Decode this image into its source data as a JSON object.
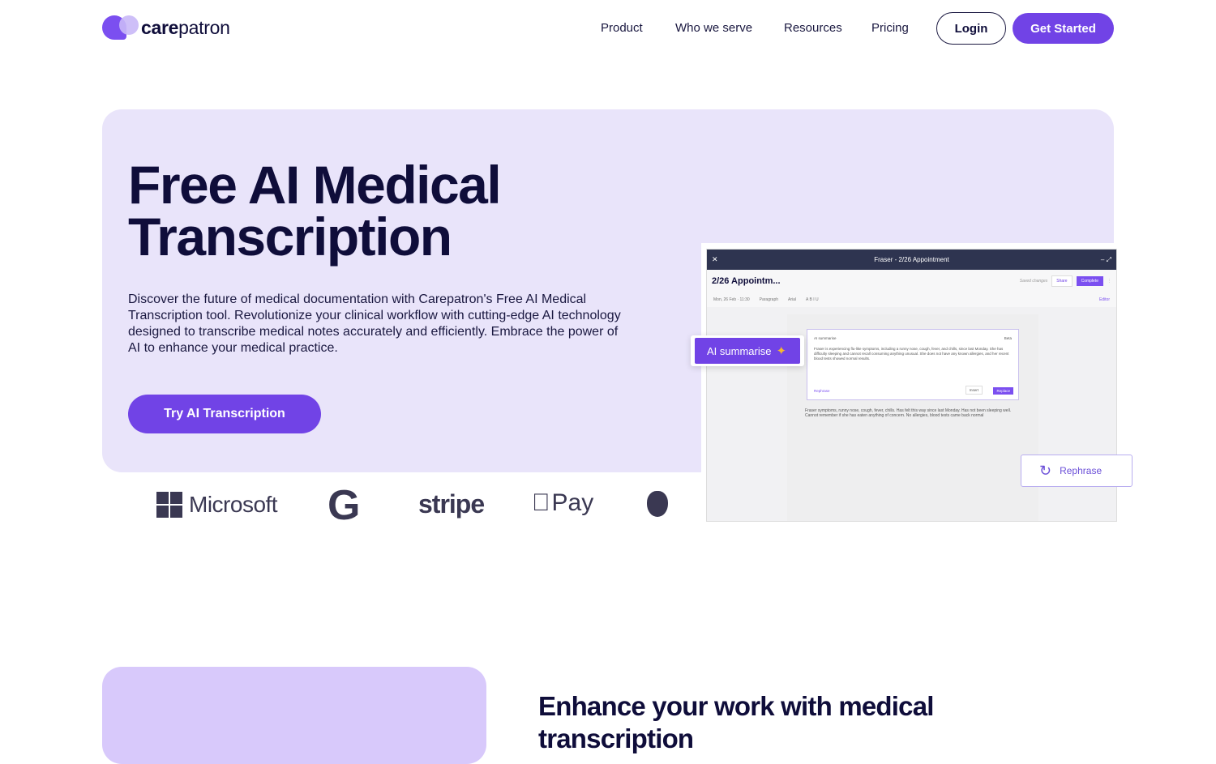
{
  "nav": {
    "brand_bold": "care",
    "brand_light": "patron",
    "items": [
      {
        "label": "Product"
      },
      {
        "label": "Who we serve"
      },
      {
        "label": "Resources"
      },
      {
        "label": "Pricing"
      }
    ],
    "login_label": "Login",
    "get_started_label": "Get Started"
  },
  "hero": {
    "title": "Free AI Medical Transcription",
    "description": "Discover the future of medical documentation with Carepatron's Free AI Medical Transcription tool. Revolutionize your clinical workflow with cutting-edge AI technology designed to transcribe medical notes accurately and efficiently. Embrace the power of AI to enhance your medical practice.",
    "cta_label": "Try AI Transcription"
  },
  "logos": [
    "Microsoft",
    "G",
    "stripe",
    "Pay"
  ],
  "mockup": {
    "window_title": "Fraser - 2/26 Appointment",
    "doc_title": "2/26 Appointm...",
    "saved": "Saved changes",
    "share": "Share",
    "complete": "Complete",
    "date": "Mon, 26 Feb · 11:30",
    "paragraph": "Paragraph",
    "font": "Arial",
    "editor": "Editor",
    "summary_label": "AI summarise",
    "beta": "Beta",
    "summary_text": "Fraser is experiencing flu-like symptoms, including a runny nose, cough, fever, and chills, since last Monday. She has difficulty sleeping and cannot recall consuming anything unusual. She does not have any known allergies, and her recent blood tests showed normal results.",
    "rephrase_small": "Rephrase",
    "insert": "Insert",
    "replace": "Replace",
    "notes": "Fraser symptoms, runny nose, cough, fever, chills. Has felt this way since last Monday. Has not been sleeping well. Cannot remember if she has eaten anything of concern. No allergies, blood tests came back normal",
    "ai_chip": "AI summarise",
    "rephrase_chip": "Rephrase"
  },
  "section2": {
    "title": "Enhance your work with medical transcription"
  },
  "colors": {
    "primary": "#7143e6",
    "hero_bg": "#e9e4fa",
    "text": "#0f0d3a"
  }
}
